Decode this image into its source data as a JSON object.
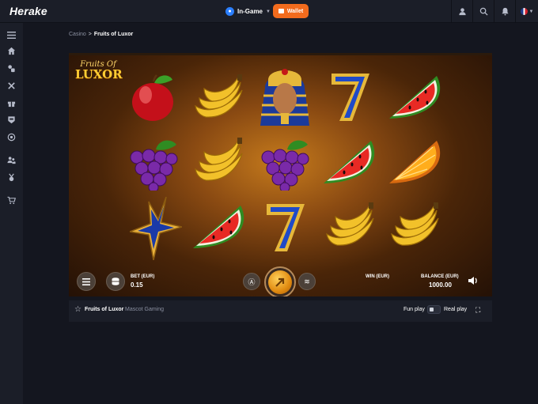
{
  "header": {
    "logo": "Herake",
    "mode_label": "In-Game",
    "wallet_label": "Wallet",
    "icons": [
      "user-icon",
      "search-icon",
      "bell-icon",
      "uk-flag-icon",
      "chevron-down-icon"
    ]
  },
  "sidebar": {
    "items": [
      {
        "icon": "menu-icon"
      },
      {
        "icon": "home-icon"
      },
      {
        "icon": "casino-icon"
      },
      {
        "icon": "sports-icon"
      },
      {
        "icon": "gift-icon"
      },
      {
        "icon": "shield-icon"
      },
      {
        "icon": "target-icon"
      },
      {
        "icon": "users-icon"
      },
      {
        "icon": "medal-icon"
      },
      {
        "icon": "cart-icon"
      }
    ]
  },
  "breadcrumb": {
    "root": "Casino",
    "separator": ">",
    "current": "Fruits of Luxor"
  },
  "game": {
    "title_line1": "Fruits Of",
    "title_line2": "LUXOR",
    "reels": [
      [
        "apple",
        "grapes",
        "star"
      ],
      [
        "bananas",
        "bananas",
        "watermelon"
      ],
      [
        "pharaoh",
        "grapes",
        "seven"
      ],
      [
        "seven",
        "watermelon",
        "bananas"
      ],
      [
        "watermelon",
        "orange",
        "bananas"
      ]
    ],
    "controls": {
      "bet_label": "BET (EUR)",
      "bet_value": "0.15",
      "win_label": "WIN (EUR)",
      "balance_label": "BALANCE (EUR)",
      "balance_value": "1000.00"
    }
  },
  "game_bar": {
    "title": "Fruits of Luxor",
    "provider": "Mascot Gaming",
    "fun_play": "Fun play",
    "real_play": "Real play"
  },
  "colors": {
    "accent_orange": "#f26b1d",
    "accent_blue": "#2b7fff",
    "bg": "#14161f",
    "panel": "#1b1e28"
  }
}
